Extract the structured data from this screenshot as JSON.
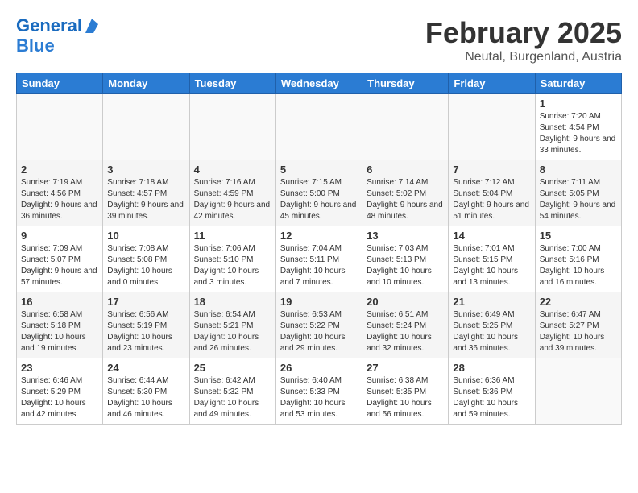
{
  "header": {
    "logo_line1": "General",
    "logo_line2": "Blue",
    "month": "February 2025",
    "location": "Neutal, Burgenland, Austria"
  },
  "weekdays": [
    "Sunday",
    "Monday",
    "Tuesday",
    "Wednesday",
    "Thursday",
    "Friday",
    "Saturday"
  ],
  "weeks": [
    [
      {
        "day": "",
        "info": ""
      },
      {
        "day": "",
        "info": ""
      },
      {
        "day": "",
        "info": ""
      },
      {
        "day": "",
        "info": ""
      },
      {
        "day": "",
        "info": ""
      },
      {
        "day": "",
        "info": ""
      },
      {
        "day": "1",
        "info": "Sunrise: 7:20 AM\nSunset: 4:54 PM\nDaylight: 9 hours and 33 minutes."
      }
    ],
    [
      {
        "day": "2",
        "info": "Sunrise: 7:19 AM\nSunset: 4:56 PM\nDaylight: 9 hours and 36 minutes."
      },
      {
        "day": "3",
        "info": "Sunrise: 7:18 AM\nSunset: 4:57 PM\nDaylight: 9 hours and 39 minutes."
      },
      {
        "day": "4",
        "info": "Sunrise: 7:16 AM\nSunset: 4:59 PM\nDaylight: 9 hours and 42 minutes."
      },
      {
        "day": "5",
        "info": "Sunrise: 7:15 AM\nSunset: 5:00 PM\nDaylight: 9 hours and 45 minutes."
      },
      {
        "day": "6",
        "info": "Sunrise: 7:14 AM\nSunset: 5:02 PM\nDaylight: 9 hours and 48 minutes."
      },
      {
        "day": "7",
        "info": "Sunrise: 7:12 AM\nSunset: 5:04 PM\nDaylight: 9 hours and 51 minutes."
      },
      {
        "day": "8",
        "info": "Sunrise: 7:11 AM\nSunset: 5:05 PM\nDaylight: 9 hours and 54 minutes."
      }
    ],
    [
      {
        "day": "9",
        "info": "Sunrise: 7:09 AM\nSunset: 5:07 PM\nDaylight: 9 hours and 57 minutes."
      },
      {
        "day": "10",
        "info": "Sunrise: 7:08 AM\nSunset: 5:08 PM\nDaylight: 10 hours and 0 minutes."
      },
      {
        "day": "11",
        "info": "Sunrise: 7:06 AM\nSunset: 5:10 PM\nDaylight: 10 hours and 3 minutes."
      },
      {
        "day": "12",
        "info": "Sunrise: 7:04 AM\nSunset: 5:11 PM\nDaylight: 10 hours and 7 minutes."
      },
      {
        "day": "13",
        "info": "Sunrise: 7:03 AM\nSunset: 5:13 PM\nDaylight: 10 hours and 10 minutes."
      },
      {
        "day": "14",
        "info": "Sunrise: 7:01 AM\nSunset: 5:15 PM\nDaylight: 10 hours and 13 minutes."
      },
      {
        "day": "15",
        "info": "Sunrise: 7:00 AM\nSunset: 5:16 PM\nDaylight: 10 hours and 16 minutes."
      }
    ],
    [
      {
        "day": "16",
        "info": "Sunrise: 6:58 AM\nSunset: 5:18 PM\nDaylight: 10 hours and 19 minutes."
      },
      {
        "day": "17",
        "info": "Sunrise: 6:56 AM\nSunset: 5:19 PM\nDaylight: 10 hours and 23 minutes."
      },
      {
        "day": "18",
        "info": "Sunrise: 6:54 AM\nSunset: 5:21 PM\nDaylight: 10 hours and 26 minutes."
      },
      {
        "day": "19",
        "info": "Sunrise: 6:53 AM\nSunset: 5:22 PM\nDaylight: 10 hours and 29 minutes."
      },
      {
        "day": "20",
        "info": "Sunrise: 6:51 AM\nSunset: 5:24 PM\nDaylight: 10 hours and 32 minutes."
      },
      {
        "day": "21",
        "info": "Sunrise: 6:49 AM\nSunset: 5:25 PM\nDaylight: 10 hours and 36 minutes."
      },
      {
        "day": "22",
        "info": "Sunrise: 6:47 AM\nSunset: 5:27 PM\nDaylight: 10 hours and 39 minutes."
      }
    ],
    [
      {
        "day": "23",
        "info": "Sunrise: 6:46 AM\nSunset: 5:29 PM\nDaylight: 10 hours and 42 minutes."
      },
      {
        "day": "24",
        "info": "Sunrise: 6:44 AM\nSunset: 5:30 PM\nDaylight: 10 hours and 46 minutes."
      },
      {
        "day": "25",
        "info": "Sunrise: 6:42 AM\nSunset: 5:32 PM\nDaylight: 10 hours and 49 minutes."
      },
      {
        "day": "26",
        "info": "Sunrise: 6:40 AM\nSunset: 5:33 PM\nDaylight: 10 hours and 53 minutes."
      },
      {
        "day": "27",
        "info": "Sunrise: 6:38 AM\nSunset: 5:35 PM\nDaylight: 10 hours and 56 minutes."
      },
      {
        "day": "28",
        "info": "Sunrise: 6:36 AM\nSunset: 5:36 PM\nDaylight: 10 hours and 59 minutes."
      },
      {
        "day": "",
        "info": ""
      }
    ]
  ]
}
